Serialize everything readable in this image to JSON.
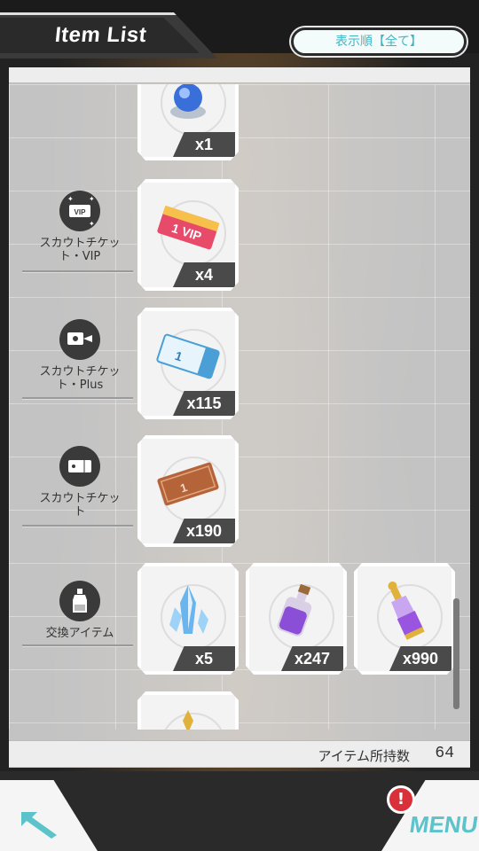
{
  "header": {
    "title": "Item List",
    "sort_label": "表示順【全て】"
  },
  "categories": [
    {
      "label_line1": "スカウトチケッ",
      "label_line2": "ト・VIP",
      "icon": "vip-ticket-icon"
    },
    {
      "label_line1": "スカウトチケッ",
      "label_line2": "ト・Plus",
      "icon": "plus-ticket-icon"
    },
    {
      "label_line1": "スカウトチケッ",
      "label_line2": "ト",
      "icon": "ticket-icon"
    },
    {
      "label_line1": "交換アイテム",
      "label_line2": "",
      "icon": "potion-bottle-icon"
    }
  ],
  "items": [
    {
      "count": "x1",
      "icon": "crystal-orb-item-icon"
    },
    {
      "count": "x4",
      "icon": "vip-ticket-item-icon"
    },
    {
      "count": "x115",
      "icon": "plus-ticket-item-icon"
    },
    {
      "count": "x190",
      "icon": "scout-ticket-item-icon"
    },
    {
      "count": "x5",
      "icon": "blue-crystal-item-icon"
    },
    {
      "count": "x247",
      "icon": "purple-potion-item-icon"
    },
    {
      "count": "x990",
      "icon": "gold-elixir-item-icon"
    }
  ],
  "footer": {
    "item_count_label": "アイテム所持数",
    "item_count_value": "64"
  },
  "nav": {
    "menu_label": "MENU",
    "alert": "!"
  },
  "colors": {
    "accent": "#5bc3c9",
    "alert": "#d9303a",
    "panel": "#ececec"
  }
}
